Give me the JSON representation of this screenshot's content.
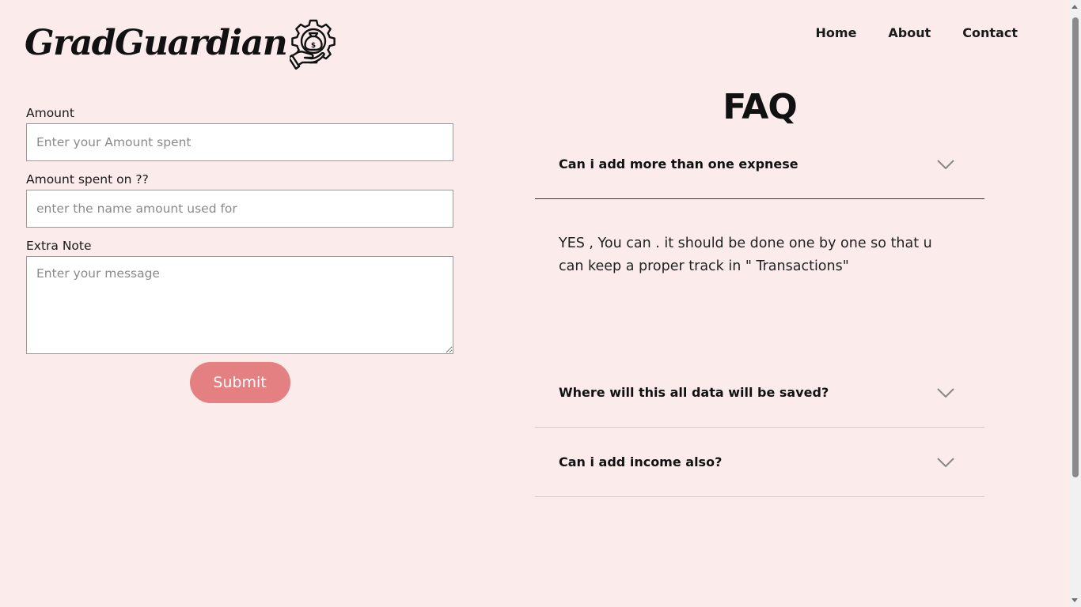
{
  "brand": {
    "name": "GradGuardian",
    "logo_icon": "gear-hand-money-bag-icon"
  },
  "nav": [
    {
      "label": "Home"
    },
    {
      "label": "About"
    },
    {
      "label": "Contact"
    }
  ],
  "form": {
    "amount_label": "Amount",
    "amount_placeholder": "Enter your Amount spent",
    "spent_on_label": "Amount spent on ??",
    "spent_on_placeholder": "enter the name amount used for",
    "note_label": "Extra Note",
    "note_placeholder": "Enter your message",
    "submit_label": "Submit"
  },
  "faq": {
    "title": "FAQ",
    "items": [
      {
        "question": "Can i add more than one expnese",
        "answer": "YES , You can . it should be done one by one so that u can keep a proper track in \" Transactions\"",
        "open": true
      },
      {
        "question": "Where will this all data will be saved?",
        "open": false
      },
      {
        "question": "Can i add income also?",
        "open": false
      }
    ]
  },
  "colors": {
    "background": "#fbebeb",
    "submit_button": "#e48081",
    "text": "#1a1a1a"
  }
}
